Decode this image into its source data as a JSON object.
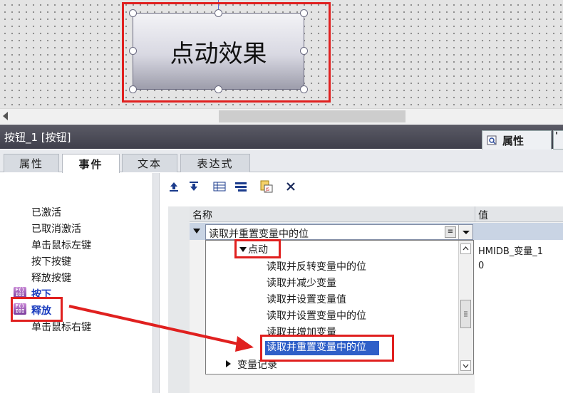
{
  "screen_button": {
    "label": "点动效果"
  },
  "panel": {
    "title": "按钮_1 [按钮]",
    "properties_tab": "属性",
    "properties_tab_next": "'"
  },
  "subtabs": [
    "属性",
    "事件",
    "文本",
    "表达式"
  ],
  "events": {
    "items": [
      "已激活",
      "已取消激活",
      "单击鼠标左键",
      "按下按键",
      "释放按键",
      "按下",
      "释放",
      "单击鼠标右键"
    ]
  },
  "grid": {
    "col_name": "名称",
    "col_value": "值",
    "row1_function": "读取并重置变量中的位",
    "values": [
      "HMIDB_变量_1",
      "0"
    ]
  },
  "dropdown": {
    "category": "点动",
    "items": [
      "读取并反转变量中的位",
      "读取并减少变量",
      "读取并设置变量值",
      "读取并设置变量中的位",
      "读取并增加变量",
      "读取并重置变量中的位"
    ],
    "next_category": "变量记录"
  },
  "icons": {
    "event_icon_text": "F()\nIOI"
  },
  "colors": {
    "highlight_red": "#e0201f",
    "selection_blue": "#2f5fc8"
  }
}
